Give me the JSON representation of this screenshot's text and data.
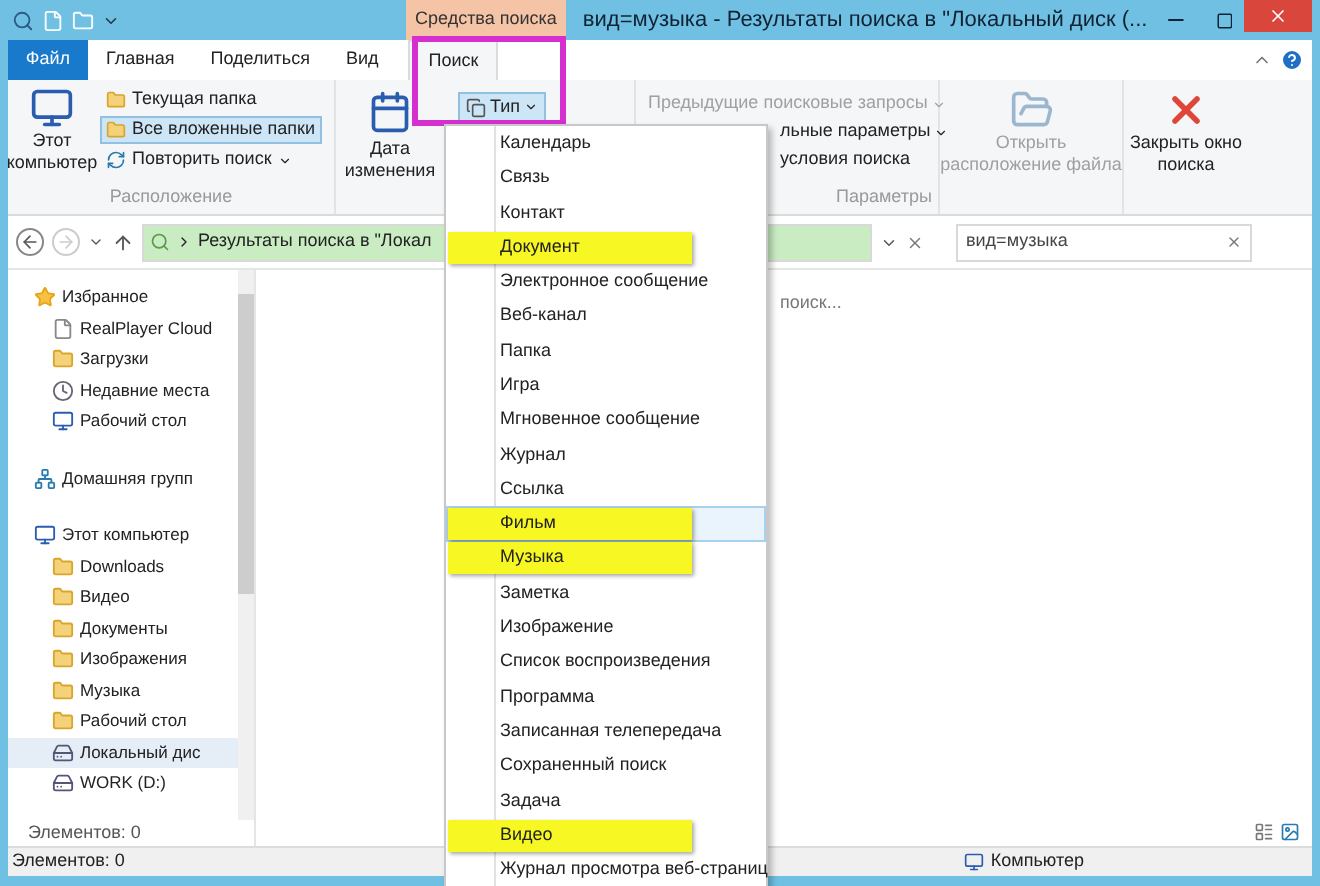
{
  "window": {
    "context_tab": "Средства поиска",
    "title": "вид=музыка - Результаты поиска в \"Локальный диск (..."
  },
  "tabs": [
    {
      "label": "Файл",
      "kind": "file",
      "selected": false,
      "outlined": false
    },
    {
      "label": "Главная",
      "kind": "tab",
      "selected": false,
      "outlined": false
    },
    {
      "label": "Поделиться",
      "kind": "tab",
      "selected": false,
      "outlined": false
    },
    {
      "label": "Вид",
      "kind": "tab",
      "selected": false,
      "outlined": false
    },
    {
      "label": "Поиск",
      "kind": "tab",
      "selected": true,
      "outlined": true
    }
  ],
  "ribbon": {
    "this_pc": "Этот компьютер",
    "location_options": [
      {
        "label": "Текущая папка",
        "selected": false,
        "dropdown": false
      },
      {
        "label": "Все вложенные папки",
        "selected": true,
        "dropdown": false
      },
      {
        "label": "Повторить поиск",
        "selected": false,
        "dropdown": true
      }
    ],
    "location_label": "Расположение",
    "date_modified": "Дата изменения",
    "type_button": "Тип",
    "recent_searches": {
      "label": "Предыдущие поисковые запросы",
      "disabled": true
    },
    "advanced": "льные параметры",
    "save_search": "условия поиска",
    "options_label": "Параметры",
    "open_location": {
      "label": "Открыть расположение файла",
      "disabled": true
    },
    "close_search": "Закрыть окно поиска"
  },
  "address": {
    "path": "Результаты поиска в \"Локал",
    "search_value": "вид=музыка"
  },
  "content": {
    "status_text": "поиск..."
  },
  "nav": {
    "items": [
      {
        "label": "Избранное",
        "kind": "favorites",
        "selected": false,
        "children": [
          {
            "label": "RealPlayer Cloud",
            "kind": "file",
            "selected": false
          },
          {
            "label": "Загрузки",
            "kind": "folder",
            "selected": false
          },
          {
            "label": "Недавние места",
            "kind": "recent",
            "selected": false
          },
          {
            "label": "Рабочий стол",
            "kind": "desktop",
            "selected": false
          }
        ]
      },
      {
        "label": "Домашняя групп",
        "kind": "homegroup",
        "selected": false
      },
      {
        "label": "Этот компьютер",
        "kind": "computer",
        "selected": false,
        "children": [
          {
            "label": "Downloads",
            "kind": "folder",
            "selected": false
          },
          {
            "label": "Видео",
            "kind": "folder",
            "selected": false
          },
          {
            "label": "Документы",
            "kind": "folder",
            "selected": false
          },
          {
            "label": "Изображения",
            "kind": "folder",
            "selected": false
          },
          {
            "label": "Музыка",
            "kind": "folder",
            "selected": false
          },
          {
            "label": "Рабочий стол",
            "kind": "folder",
            "selected": false
          },
          {
            "label": "Локальный дис",
            "kind": "drive",
            "selected": true
          },
          {
            "label": "WORK (D:)",
            "kind": "drive",
            "selected": false
          }
        ]
      }
    ],
    "count": "Элементов: 0"
  },
  "status_bar": {
    "count": "Элементов: 0",
    "location": "Компьютер"
  },
  "type_menu": {
    "items": [
      {
        "label": "Календарь",
        "highlighted": false,
        "hovered": false
      },
      {
        "label": "Связь",
        "highlighted": false,
        "hovered": false
      },
      {
        "label": "Контакт",
        "highlighted": false,
        "hovered": false
      },
      {
        "label": "Документ",
        "highlighted": true,
        "hovered": false
      },
      {
        "label": "Электронное сообщение",
        "highlighted": false,
        "hovered": false
      },
      {
        "label": "Веб-канал",
        "highlighted": false,
        "hovered": false
      },
      {
        "label": "Папка",
        "highlighted": false,
        "hovered": false
      },
      {
        "label": "Игра",
        "highlighted": false,
        "hovered": false
      },
      {
        "label": "Мгновенное сообщение",
        "highlighted": false,
        "hovered": false
      },
      {
        "label": "Журнал",
        "highlighted": false,
        "hovered": false
      },
      {
        "label": "Ссылка",
        "highlighted": false,
        "hovered": false
      },
      {
        "label": "Фильм",
        "highlighted": true,
        "hovered": true
      },
      {
        "label": "Музыка",
        "highlighted": true,
        "hovered": false
      },
      {
        "label": "Заметка",
        "highlighted": false,
        "hovered": false
      },
      {
        "label": "Изображение",
        "highlighted": false,
        "hovered": false
      },
      {
        "label": "Список воспроизведения",
        "highlighted": false,
        "hovered": false
      },
      {
        "label": "Программа",
        "highlighted": false,
        "hovered": false
      },
      {
        "label": "Записанная телепередача",
        "highlighted": false,
        "hovered": false
      },
      {
        "label": "Сохраненный поиск",
        "highlighted": false,
        "hovered": false
      },
      {
        "label": "Задача",
        "highlighted": false,
        "hovered": false
      },
      {
        "label": "Видео",
        "highlighted": true,
        "hovered": false
      },
      {
        "label": "Журнал просмотра веб-страниц",
        "highlighted": false,
        "hovered": false
      }
    ]
  }
}
